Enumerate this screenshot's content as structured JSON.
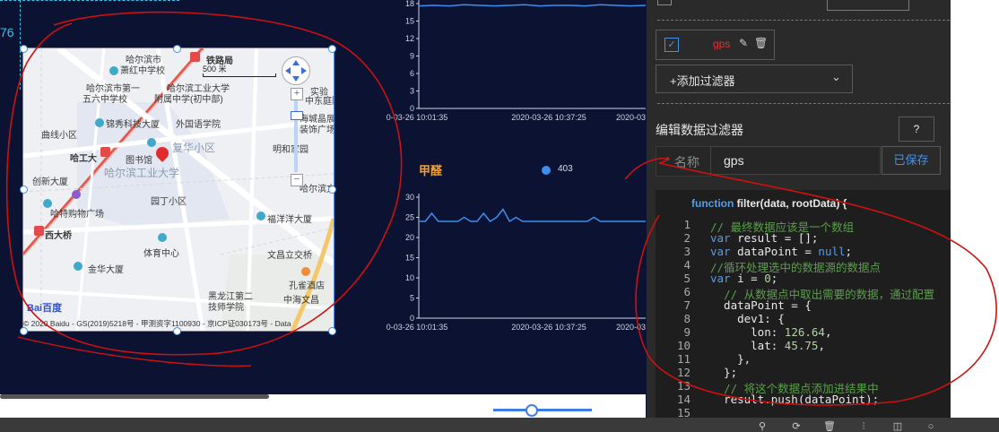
{
  "canvas": {
    "partial_number": "76",
    "map": {
      "labels": [
        {
          "text": "哈尔滨市",
          "cls": ""
        },
        {
          "text": "萧红中学校",
          "cls": ""
        },
        {
          "text": "铁路局",
          "cls": ""
        },
        {
          "text": "哈尔滨市第一",
          "cls": ""
        },
        {
          "text": "五六中学校",
          "cls": ""
        },
        {
          "text": "哈尔滨工业大学",
          "cls": ""
        },
        {
          "text": "附属中学(初中部)",
          "cls": ""
        },
        {
          "text": "锦秀科技大厦",
          "cls": ""
        },
        {
          "text": "外国语学院",
          "cls": ""
        },
        {
          "text": "曲线小区",
          "cls": ""
        },
        {
          "text": "哈工大",
          "cls": ""
        },
        {
          "text": "复华小区",
          "cls": "map-big"
        },
        {
          "text": "图书馆",
          "cls": ""
        },
        {
          "text": "哈尔滨工业大学",
          "cls": "map-big"
        },
        {
          "text": "创新大厦",
          "cls": ""
        },
        {
          "text": "园丁小区",
          "cls": ""
        },
        {
          "text": "哈特购物广场",
          "cls": ""
        },
        {
          "text": "西大桥",
          "cls": ""
        },
        {
          "text": "体育中心",
          "cls": ""
        },
        {
          "text": "福洋洋大厦",
          "cls": ""
        },
        {
          "text": "文昌立交桥",
          "cls": ""
        },
        {
          "text": "金华大厦",
          "cls": ""
        },
        {
          "text": "孔雀酒店",
          "cls": ""
        },
        {
          "text": "黑龙江第二",
          "cls": ""
        },
        {
          "text": "技师学院",
          "cls": ""
        },
        {
          "text": "中海文昌",
          "cls": ""
        },
        {
          "text": "实验",
          "cls": ""
        },
        {
          "text": "中东庭院",
          "cls": ""
        },
        {
          "text": "海城晶展",
          "cls": ""
        },
        {
          "text": "装饰广场",
          "cls": ""
        },
        {
          "text": "明和家园",
          "cls": ""
        },
        {
          "text": "哈尔滨文",
          "cls": ""
        }
      ],
      "scale": "500 米",
      "copyright": "© 2020 Baidu - GS(2019)5218号 - 甲测资字1100930 - 京ICP证030173号 - Data",
      "logo": "Bai百度"
    },
    "chart_data": [
      {
        "type": "line",
        "title": "",
        "ylim": [
          0,
          18
        ],
        "yticks": [
          0,
          3,
          6,
          9,
          12,
          15,
          18
        ],
        "xticks": [
          "0-03-26 10:01:35",
          "2020-03-26 10:37:25",
          "2020-03-"
        ],
        "series": [
          {
            "values": [
              17.6,
              17.7,
              17.6,
              17.8,
              17.7,
              17.6,
              17.7,
              17.8,
              17.6,
              17.7,
              17.7,
              17.6,
              17.8,
              17.7,
              17.6,
              17.7
            ]
          }
        ],
        "color": "#3d8ef0"
      },
      {
        "type": "line",
        "title": "甲醛",
        "legend_value": "403",
        "ylim": [
          0,
          30
        ],
        "yticks": [
          0,
          5,
          10,
          15,
          20,
          25,
          30
        ],
        "xticks": [
          "0-03-26 10:01:35",
          "2020-03-26 10:37:25",
          "2020-03-"
        ],
        "series": [
          {
            "values": [
              24,
              24,
              26,
              24,
              24,
              24,
              24,
              25,
              24,
              24,
              26,
              24,
              25,
              27,
              24,
              25,
              24,
              24,
              24,
              24,
              24,
              24,
              24,
              24,
              24,
              24,
              24,
              25,
              24,
              24,
              24,
              24,
              24,
              24,
              24,
              24
            ]
          }
        ],
        "color": "#3d8ef0"
      }
    ]
  },
  "panel": {
    "filter_item_label": "gps",
    "add_filter_label": "+添加过滤器",
    "edit_title": "编辑数据过滤器",
    "help_label": "?",
    "name_label": "名称",
    "name_required": "*",
    "name_value": "gps",
    "saved_label": "已保存",
    "function_signature": "function filter(data, rootData) {",
    "code_lines": [
      {
        "n": "1",
        "html": "<span class=\"cm\">// 最终数据应该是一个数组</span>"
      },
      {
        "n": "2",
        "html": "<span class=\"kw\">var</span> result = [];"
      },
      {
        "n": "3",
        "html": "<span class=\"kw\">var</span> dataPoint = <span class=\"kw\">null</span>;"
      },
      {
        "n": "4",
        "html": "<span class=\"cm\">//循环处理选中的数据源的数据点</span>"
      },
      {
        "n": "5",
        "html": "<span class=\"kw\">var</span> i = <span class=\"num\">0</span>;"
      },
      {
        "n": "6",
        "html": "  <span class=\"cm\">// 从数据点中取出需要的数据，通过配置</span>"
      },
      {
        "n": "7",
        "html": "  dataPoint = {"
      },
      {
        "n": "8",
        "html": "    dev1: {"
      },
      {
        "n": "9",
        "html": "      lon: <span class=\"num\">126.64</span>,"
      },
      {
        "n": "10",
        "html": "      lat: <span class=\"num\">45.75</span>,"
      },
      {
        "n": "11",
        "html": "    },"
      },
      {
        "n": "12",
        "html": "  };"
      },
      {
        "n": "13",
        "html": "  <span class=\"cm\">// 将这个数据点添加进结果中</span>"
      },
      {
        "n": "14",
        "html": "  result.push(dataPoint);"
      },
      {
        "n": "15",
        "html": ""
      }
    ]
  },
  "colors": {
    "accent": "#3d8ef0",
    "annotation": "#cc1111",
    "panel_bg": "#2a2a2a",
    "canvas_bg": "#0b1232"
  }
}
